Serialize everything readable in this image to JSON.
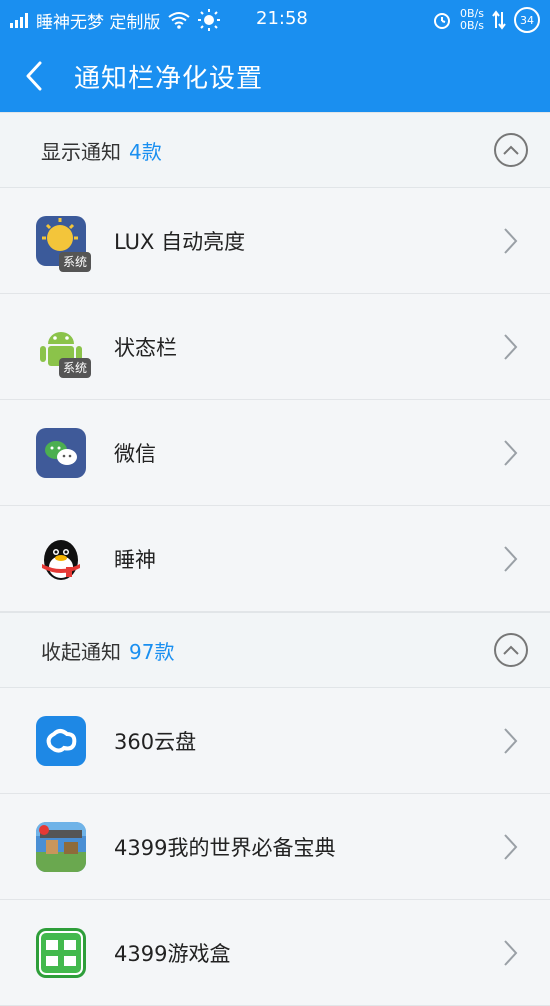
{
  "status_bar": {
    "carrier": "睡神无梦 定制版",
    "time": "21:58",
    "speed_up": "0B/s",
    "speed_down": "0B/s",
    "battery": "34"
  },
  "header": {
    "title": "通知栏净化设置"
  },
  "sections": [
    {
      "label": "显示通知",
      "count": "4款",
      "items": [
        {
          "name": "LUX 自动亮度",
          "badge": "系统"
        },
        {
          "name": "状态栏",
          "badge": "系统"
        },
        {
          "name": "微信"
        },
        {
          "name": "睡神"
        }
      ]
    },
    {
      "label": "收起通知",
      "count": "97款",
      "items": [
        {
          "name": "360云盘"
        },
        {
          "name": "4399我的世界必备宝典"
        },
        {
          "name": "4399游戏盒"
        }
      ]
    }
  ],
  "colors": {
    "accent": "#1a8ff0"
  },
  "icons": [
    "wifi-icon",
    "brightness-icon",
    "alarm-icon",
    "data-arrows-icon",
    "battery-icon",
    "back-arrow-icon",
    "chevron-up-icon",
    "chevron-right-icon"
  ]
}
